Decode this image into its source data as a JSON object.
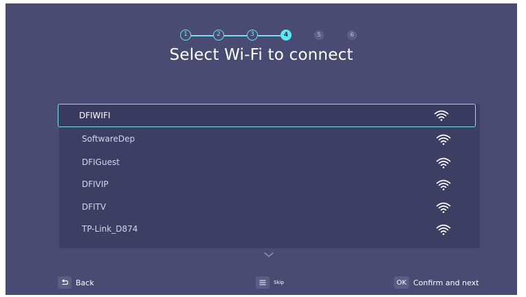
{
  "stepper": {
    "steps": [
      {
        "label": "1",
        "state": "done"
      },
      {
        "label": "2",
        "state": "done"
      },
      {
        "label": "3",
        "state": "done"
      },
      {
        "label": "4",
        "state": "active"
      },
      {
        "label": "5",
        "state": "todo"
      },
      {
        "label": "6",
        "state": "todo"
      }
    ],
    "current_step": 4,
    "total_steps": 6
  },
  "title": "Select Wi-Fi to connect",
  "networks": [
    {
      "ssid": "DFIWIFI",
      "selected": true,
      "signal_icon": "wifi-signal-icon"
    },
    {
      "ssid": "SoftwareDep",
      "selected": false,
      "signal_icon": "wifi-signal-icon"
    },
    {
      "ssid": "DFIGuest",
      "selected": false,
      "signal_icon": "wifi-signal-icon"
    },
    {
      "ssid": "DFIVIP",
      "selected": false,
      "signal_icon": "wifi-signal-icon"
    },
    {
      "ssid": "DFITV",
      "selected": false,
      "signal_icon": "wifi-signal-icon"
    },
    {
      "ssid": "TP-Link_D874",
      "selected": false,
      "signal_icon": "wifi-signal-icon"
    }
  ],
  "footer": {
    "back_label": "Back",
    "skip_label": "Skip",
    "ok_key": "OK",
    "confirm_label": "Confirm and next"
  },
  "colors": {
    "background": "#4a4b72",
    "accent": "#5ee7f3",
    "list_panel": "#3d3e64",
    "key_bg": "#5c5d84"
  }
}
